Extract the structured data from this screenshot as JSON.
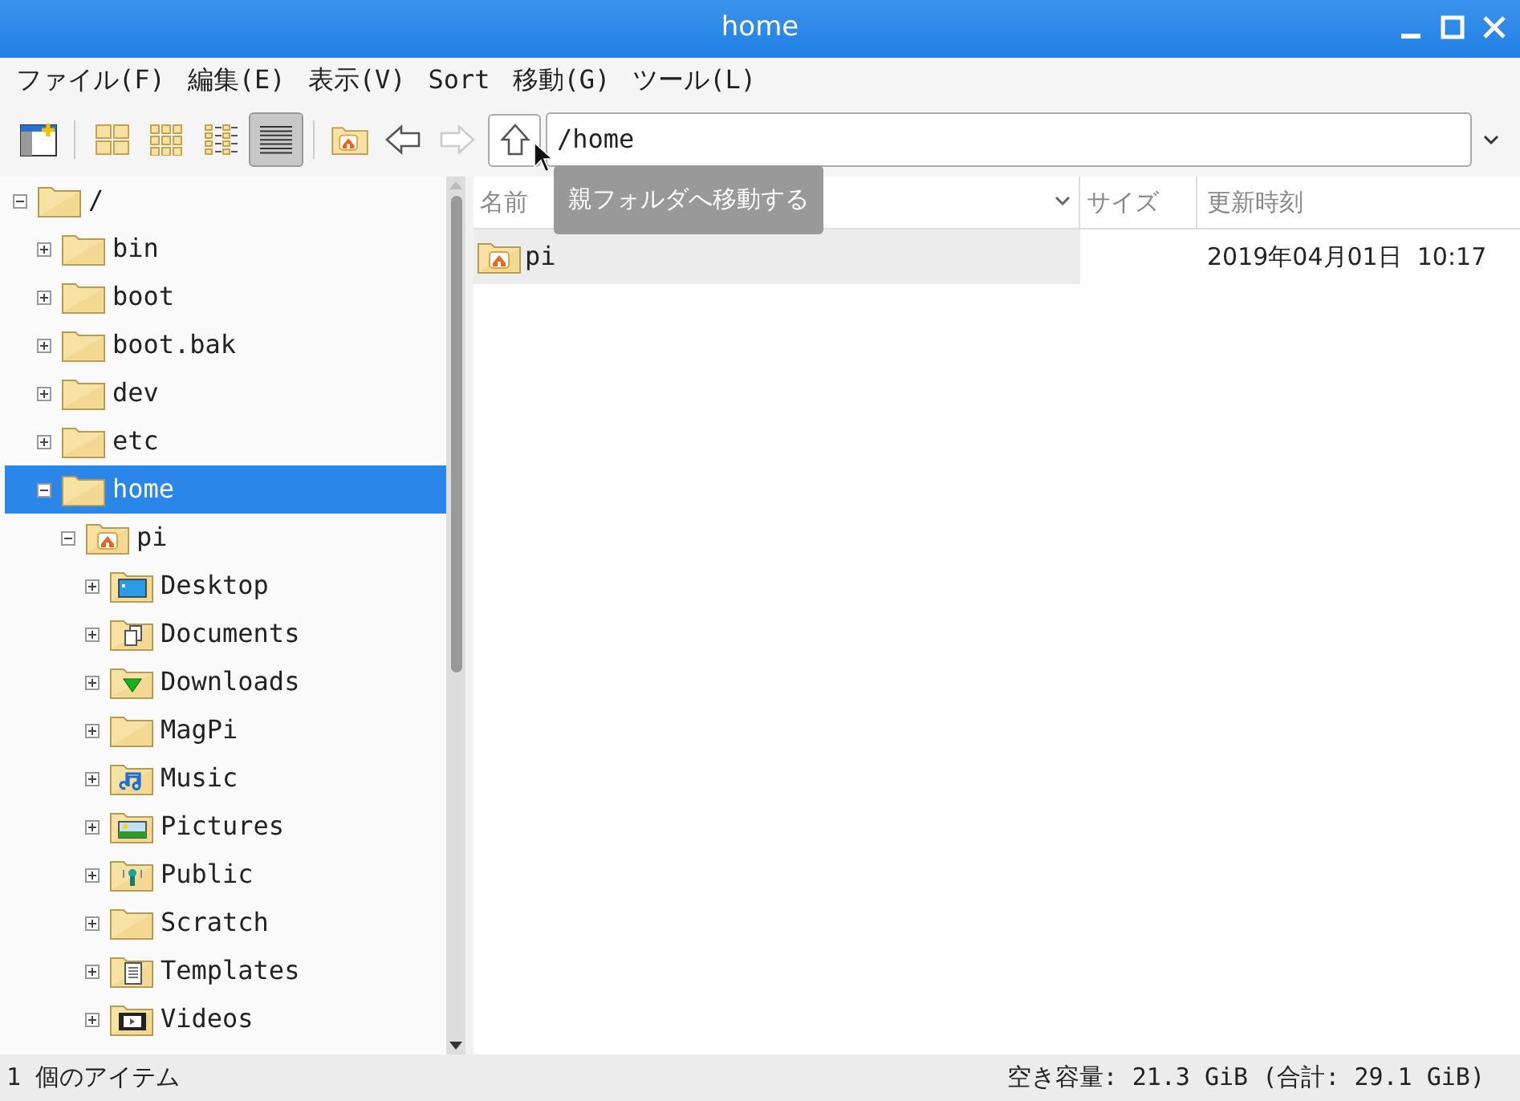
{
  "window": {
    "title": "home"
  },
  "menu": [
    "ファイル(F)",
    "編集(E)",
    "表示(V)",
    "Sort",
    "移動(G)",
    "ツール(L)"
  ],
  "toolbar": {
    "views": [
      {
        "kind": "icons",
        "selected": false
      },
      {
        "kind": "thumbnails",
        "selected": false
      },
      {
        "kind": "compact",
        "selected": false
      },
      {
        "kind": "details",
        "selected": true
      }
    ],
    "path": "/home",
    "tooltip": "親フォルダへ移動する"
  },
  "tree": [
    {
      "label": "/",
      "kind": "folder",
      "expanded": true,
      "selected": false,
      "children": [
        {
          "label": "bin",
          "kind": "folder",
          "expanded": false,
          "selected": false
        },
        {
          "label": "boot",
          "kind": "folder",
          "expanded": false,
          "selected": false
        },
        {
          "label": "boot.bak",
          "kind": "folder",
          "expanded": false,
          "selected": false
        },
        {
          "label": "dev",
          "kind": "folder",
          "expanded": false,
          "selected": false
        },
        {
          "label": "etc",
          "kind": "folder",
          "expanded": false,
          "selected": false
        },
        {
          "label": "home",
          "kind": "folder",
          "expanded": true,
          "selected": true,
          "children": [
            {
              "label": "pi",
              "kind": "home",
              "expanded": true,
              "selected": false,
              "children": [
                {
                  "label": "Desktop",
                  "kind": "desktop",
                  "expanded": false,
                  "selected": false
                },
                {
                  "label": "Documents",
                  "kind": "documents",
                  "expanded": false,
                  "selected": false
                },
                {
                  "label": "Downloads",
                  "kind": "downloads",
                  "expanded": false,
                  "selected": false
                },
                {
                  "label": "MagPi",
                  "kind": "folder",
                  "expanded": false,
                  "selected": false
                },
                {
                  "label": "Music",
                  "kind": "music",
                  "expanded": false,
                  "selected": false
                },
                {
                  "label": "Pictures",
                  "kind": "pictures",
                  "expanded": false,
                  "selected": false
                },
                {
                  "label": "Public",
                  "kind": "public",
                  "expanded": false,
                  "selected": false
                },
                {
                  "label": "Scratch",
                  "kind": "folder",
                  "expanded": false,
                  "selected": false
                },
                {
                  "label": "Templates",
                  "kind": "templates",
                  "expanded": false,
                  "selected": false
                },
                {
                  "label": "Videos",
                  "kind": "videos",
                  "expanded": false,
                  "selected": false
                }
              ]
            }
          ]
        }
      ]
    }
  ],
  "table": {
    "columns": [
      "名前",
      "サイズ",
      "更新時刻"
    ],
    "rows": [
      {
        "name": "pi",
        "kind": "home",
        "modified": "2019年04月01日  10:17",
        "selected": true
      }
    ]
  },
  "status_bar": {
    "items": "1 個のアイテム",
    "free": "空き容量: 21.3 GiB (合計: 29.1 GiB)"
  }
}
